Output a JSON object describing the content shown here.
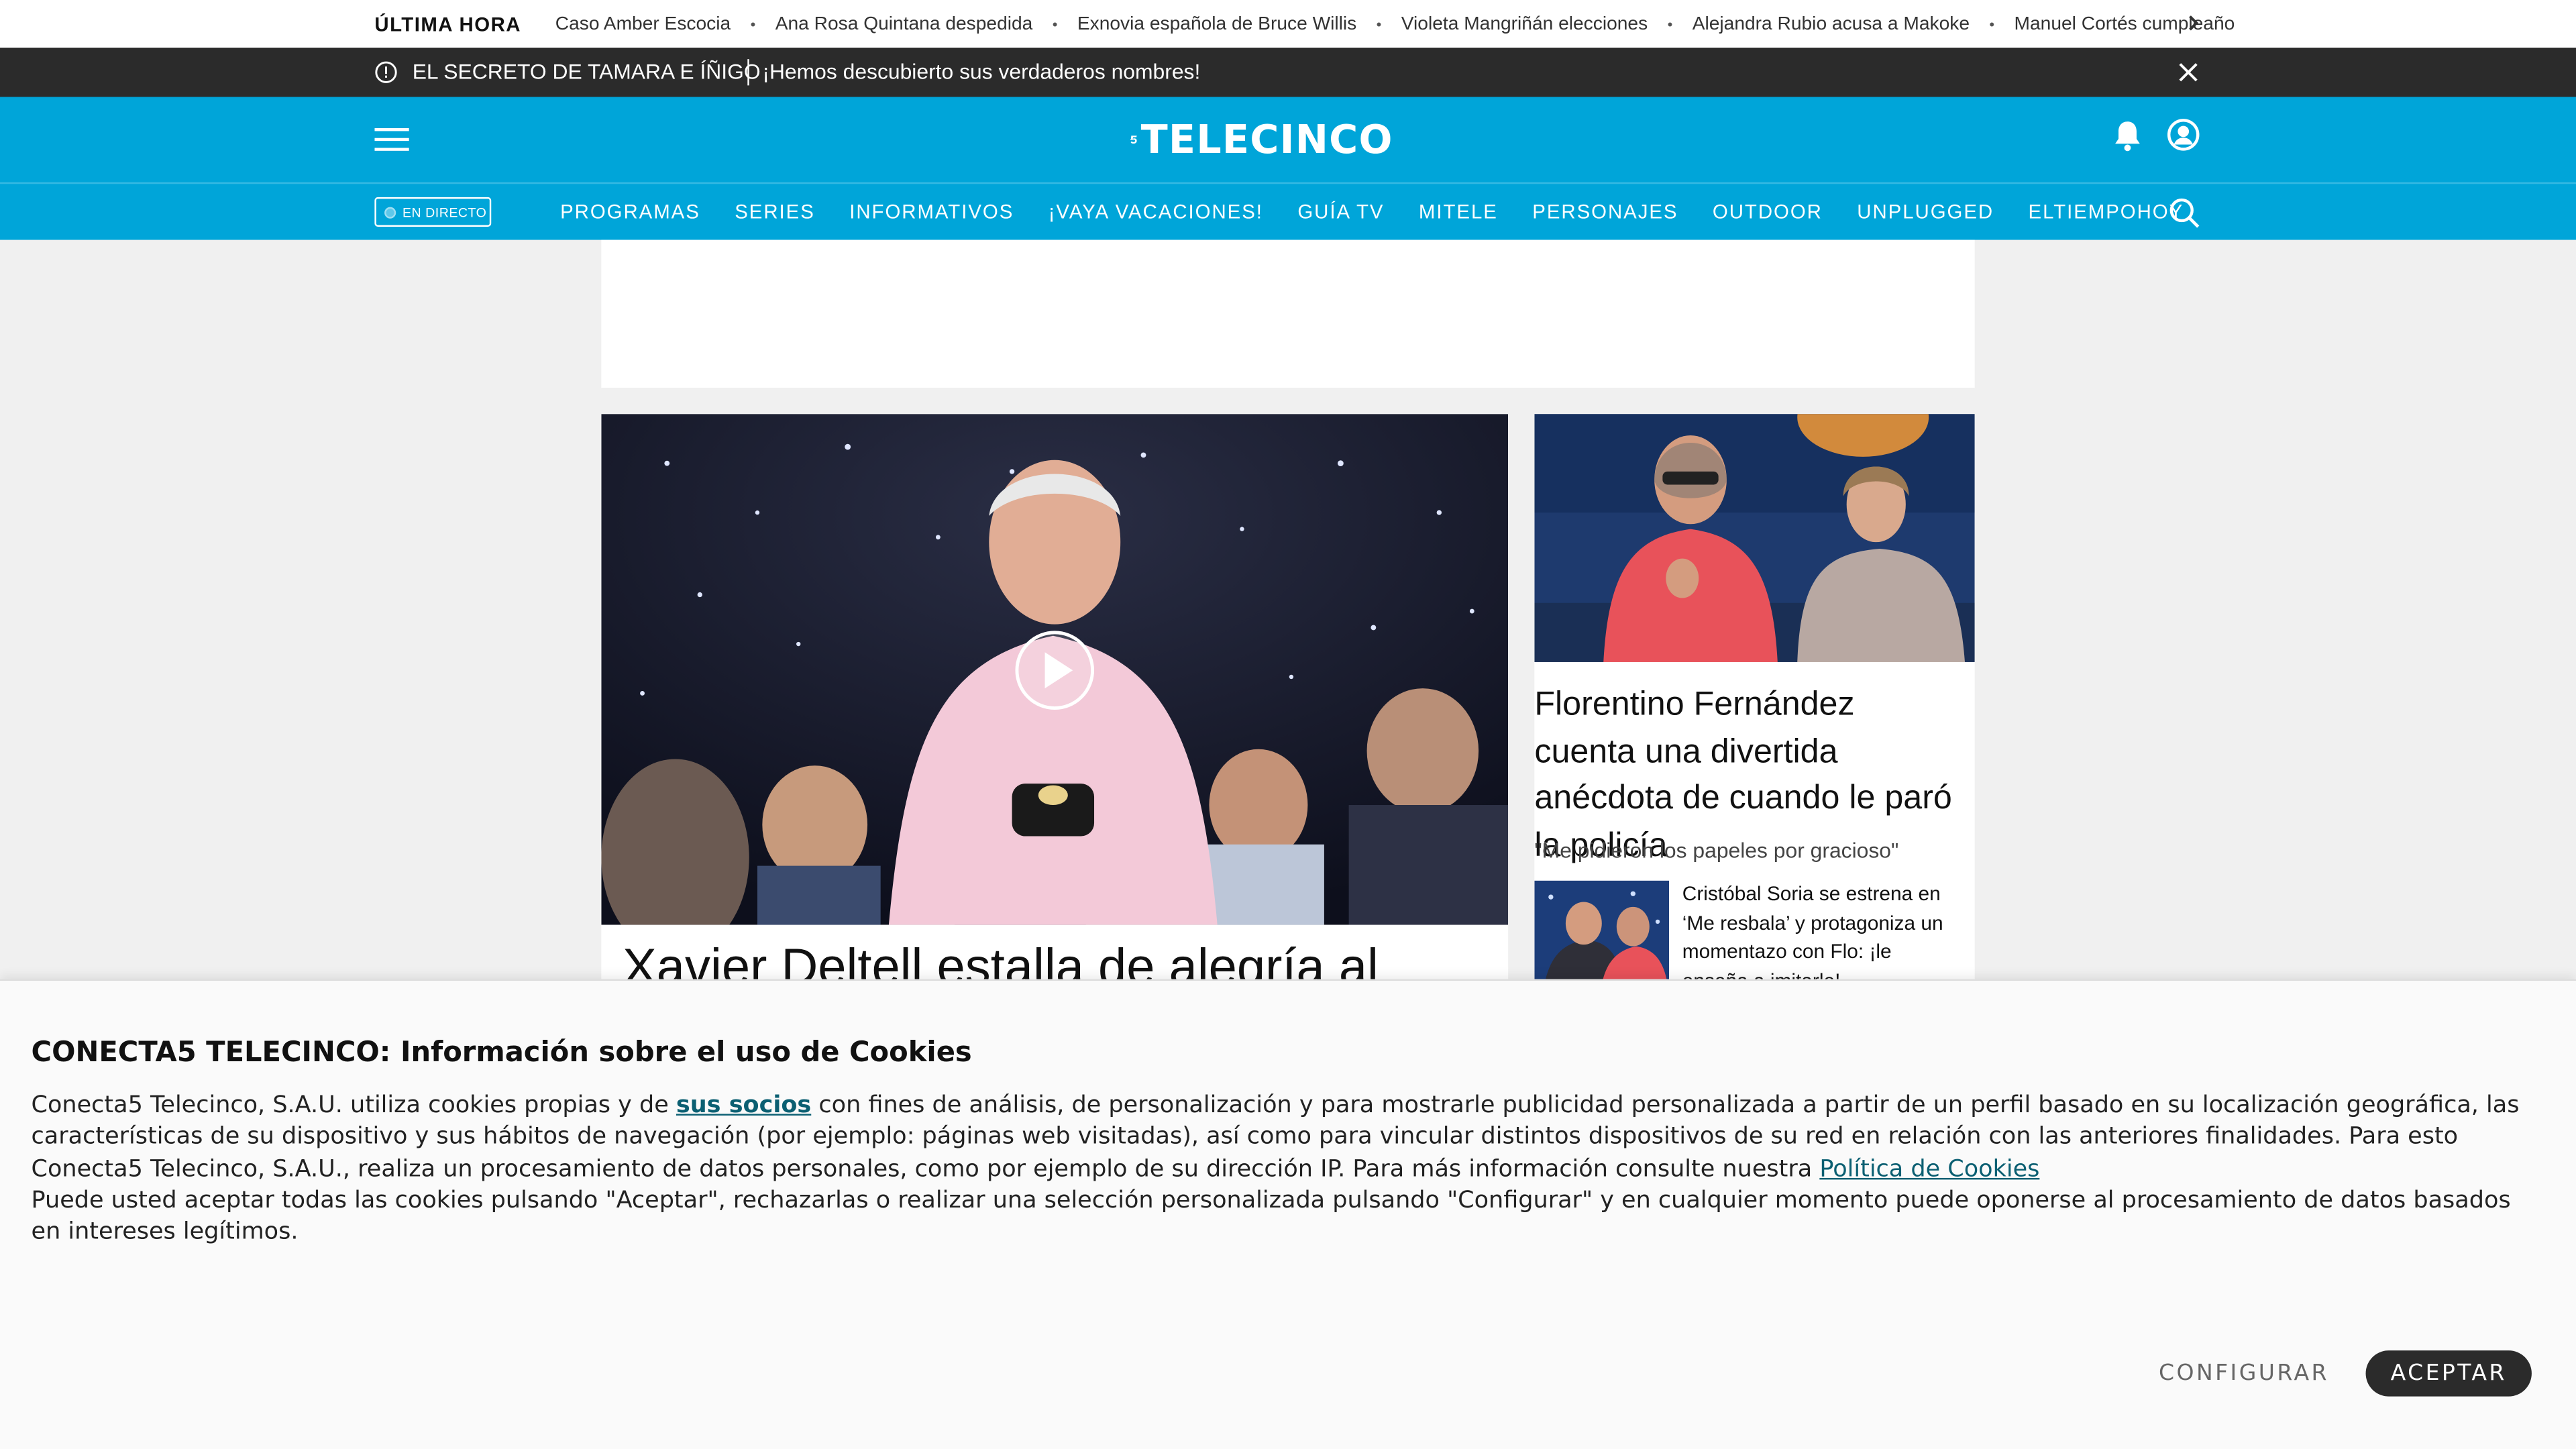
{
  "breaking": {
    "label": "ÚLTIMA HORA",
    "items": [
      "Caso Amber Escocia",
      "Ana Rosa Quintana despedida",
      "Exnovia española de Bruce Willis",
      "Violeta Mangriñán elecciones",
      "Alejandra Rubio acusa a Makoke",
      "Manuel Cortés cumpleaño"
    ],
    "separator": "•"
  },
  "alert": {
    "title": "EL SECRETO DE TAMARA E ÍÑIGO",
    "text": "¡Hemos descubierto sus verdaderos nombres!"
  },
  "header": {
    "logo_text": "TELECINCO",
    "brand_color": "#00a5d9"
  },
  "nav": {
    "live_label": "EN DIRECTO",
    "links": [
      "PROGRAMAS",
      "SERIES",
      "INFORMATIVOS",
      "¡VAYA VACACIONES!",
      "GUÍA TV",
      "MITELE",
      "PERSONAJES",
      "OUTDOOR",
      "UNPLUGGED",
      "ELTIEMPOHOY"
    ]
  },
  "main_story": {
    "headline": "Xavier Deltell estalla de alegría al"
  },
  "side_story": {
    "headline": "Florentino Fernández cuenta una divertida anécdota de cuando le paró la policía",
    "subtitle": "\"Me pidieron los papeles por gracioso\"",
    "related": "Cristóbal Soria se estrena en ‘Me resbala’ y protagoniza un momentazo con Flo: ¡le enseña a imitarle!"
  },
  "cookie": {
    "title": "CONECTA5 TELECINCO: Información sobre el uso de Cookies",
    "body_1": "Conecta5 Telecinco, S.A.U. utiliza cookies propias y de ",
    "partners_link": "sus socios",
    "body_2": " con fines de análisis, de personalización y para mostrarle publicidad personalizada a partir de un perfil basado en su localización geográfica, las características de su dispositivo y sus hábitos de navegación (por ejemplo: páginas web visitadas), así como para vincular distintos dispositivos de su red en relación con las anteriores finalidades. Para esto Conecta5 Telecinco, S.A.U., realiza un procesamiento de datos personales, como por ejemplo de su dirección IP. Para más información consulte nuestra ",
    "policy_link": "Política de Cookies",
    "body_3": "Puede usted aceptar todas las cookies pulsando \"Aceptar\", rechazarlas o realizar una selección personalizada pulsando \"Configurar\" y en cualquier momento puede oponerse al procesamiento de datos basados en intereses legítimos.",
    "configure_label": "CONFIGURAR",
    "accept_label": "ACEPTAR"
  }
}
